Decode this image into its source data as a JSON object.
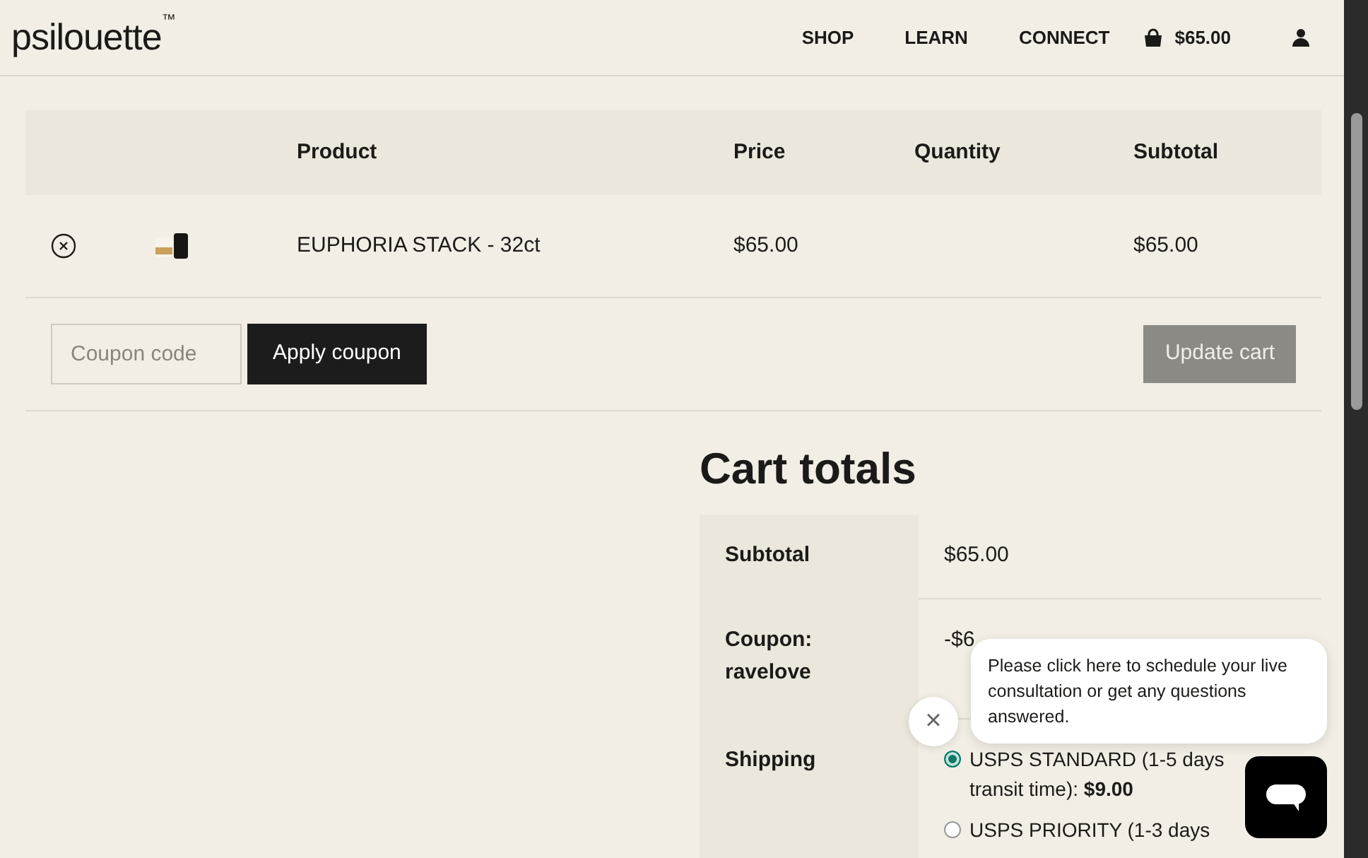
{
  "header": {
    "logo": "psilouette",
    "trademark": "™",
    "nav": [
      {
        "label": "SHOP"
      },
      {
        "label": "LEARN"
      },
      {
        "label": "CONNECT"
      }
    ],
    "cart_total": "$65.00"
  },
  "cart_table": {
    "columns": [
      "Product",
      "Price",
      "Quantity",
      "Subtotal"
    ],
    "rows": [
      {
        "product": "EUPHORIA STACK - 32ct",
        "price": "$65.00",
        "subtotal": "$65.00"
      }
    ]
  },
  "coupon": {
    "placeholder": "Coupon code",
    "apply_button": "Apply coupon",
    "update_button": "Update cart",
    "update_disabled": true
  },
  "cart_totals": {
    "title": "Cart totals",
    "subtotal_label": "Subtotal",
    "subtotal": "$65.00",
    "coupon_label": "Coupon: ravelove",
    "coupon_value": "-$6",
    "shipping_label": "Shipping",
    "shipping_options": [
      {
        "label": "USPS STANDARD (1-5 days transit time): **$9.00**",
        "selected": true
      },
      {
        "label": "USPS PRIORITY (1-3 days",
        "selected": false
      }
    ]
  },
  "chat": {
    "message": "Please click here to schedule your live consultation or get any questions answered.",
    "close": "×"
  }
}
